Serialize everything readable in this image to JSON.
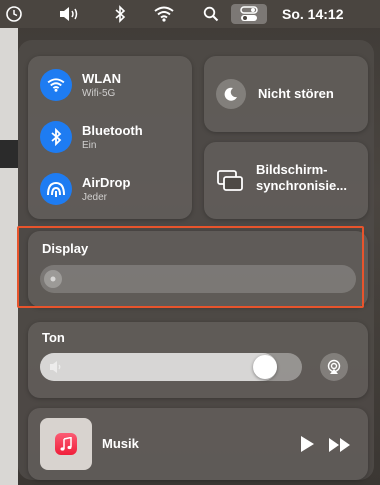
{
  "menubar": {
    "datetime": "So. 14:12",
    "icons": [
      "clock-icon",
      "volume-icon",
      "bluetooth-icon",
      "wifi-icon",
      "search-icon",
      "control-center-icon"
    ]
  },
  "network": {
    "wlan": {
      "title": "WLAN",
      "subtitle": "Wifi-5G",
      "icon": "wifi-icon"
    },
    "bluetooth": {
      "title": "Bluetooth",
      "subtitle": "Ein",
      "icon": "bluetooth-icon"
    },
    "airdrop": {
      "title": "AirDrop",
      "subtitle": "Jeder",
      "icon": "airdrop-icon"
    }
  },
  "do_not_disturb": {
    "label": "Nicht stören",
    "icon": "moon-icon"
  },
  "screen_mirroring": {
    "label_line1": "Bildschirm-",
    "label_line2": "synchronisie...",
    "icon": "screen-mirroring-icon"
  },
  "display": {
    "label": "Display",
    "brightness": 0.0
  },
  "sound": {
    "label": "Ton",
    "volume": 0.9
  },
  "music": {
    "label": "Musik",
    "icon": "music-app-icon"
  },
  "colors": {
    "accent_blue": "#1e7cf2",
    "highlight_border": "#e8542c",
    "music_red": "#f01e3a"
  }
}
